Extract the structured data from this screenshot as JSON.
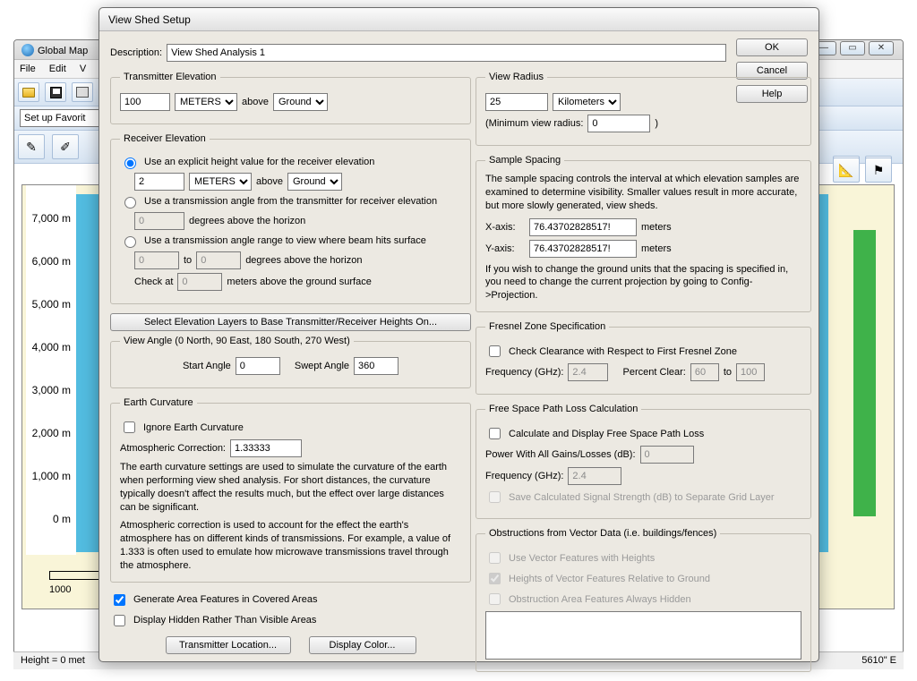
{
  "bgwin": {
    "title": "Global Map",
    "menus": [
      "File",
      "Edit",
      "V"
    ],
    "fav": "Set up Favorit"
  },
  "status": {
    "left": "Height = 0 met",
    "right": "5610\" E"
  },
  "yaxis": [
    "7,000 m",
    "6,000 m",
    "5,000 m",
    "4,000 m",
    "3,000 m",
    "2,000 m",
    "1,000 m",
    "0 m"
  ],
  "scale": "1000",
  "dialog": {
    "title": "View Shed Setup",
    "ok": "OK",
    "cancel": "Cancel",
    "help": "Help",
    "desc_label": "Description:",
    "desc": "View Shed Analysis 1",
    "tx": {
      "legend": "Transmitter Elevation",
      "val": "100",
      "unit": "METERS",
      "above": "above",
      "ref": "Ground"
    },
    "rx": {
      "legend": "Receiver Elevation",
      "opt1": "Use an explicit height value for the receiver elevation",
      "val": "2",
      "unit": "METERS",
      "above": "above",
      "ref": "Ground",
      "opt2": "Use a transmission angle from the transmitter for receiver elevation",
      "ang1": "0",
      "deg1": "degrees above the horizon",
      "opt3": "Use a transmission angle range to view where beam hits surface",
      "ang_from": "0",
      "to": "to",
      "ang_to": "0",
      "deg2": "degrees above the horizon",
      "checkat": "Check at",
      "checkval": "0",
      "checkunit": "meters above the ground surface"
    },
    "select_layers": "Select Elevation Layers to Base Transmitter/Receiver Heights On...",
    "viewangle": {
      "legend": "View Angle (0 North, 90 East, 180 South, 270 West)",
      "start_l": "Start Angle",
      "start": "0",
      "swept_l": "Swept Angle",
      "swept": "360"
    },
    "earth": {
      "legend": "Earth Curvature",
      "ignore": "Ignore Earth Curvature",
      "atm_l": "Atmospheric Correction:",
      "atm": "1.33333",
      "p1": "The earth curvature settings are used to simulate the curvature of the earth when performing view shed analysis. For short distances, the curvature typically doesn't affect the results much, but the effect over large distances can be significant.",
      "p2": "Atmospheric correction is used to account for the effect the earth's atmosphere has on different kinds of transmissions. For example, a value of 1.333 is often used to emulate how microwave transmissions travel through the atmosphere."
    },
    "gen": "Generate Area Features in Covered Areas",
    "disp": "Display Hidden Rather Than Visible Areas",
    "txloc": "Transmitter Location...",
    "dispcol": "Display Color...",
    "radius": {
      "legend": "View Radius",
      "val": "25",
      "unit": "Kilometers",
      "min_l": "(Minimum view radius:",
      "min": "0",
      "close": ")"
    },
    "spacing": {
      "legend": "Sample Spacing",
      "p": "The sample spacing controls the interval at which elevation samples are examined to determine visibility. Smaller values result in more accurate, but more slowly generated, view sheds.",
      "x_l": "X-axis:",
      "x": "76.43702828517!",
      "xu": "meters",
      "y_l": "Y-axis:",
      "y": "76.43702828517!",
      "yu": "meters",
      "p2": "If you wish to change the ground units that the spacing is specified in, you need to change the current projection by going to Config->Projection."
    },
    "fresnel": {
      "legend": "Fresnel Zone Specification",
      "check": "Check Clearance with Respect to First Fresnel Zone",
      "freq_l": "Frequency (GHz):",
      "freq": "2.4",
      "pc_l": "Percent Clear:",
      "pc_from": "60",
      "to": "to",
      "pc_to": "100"
    },
    "loss": {
      "legend": "Free Space Path Loss Calculation",
      "calc": "Calculate and Display Free Space Path Loss",
      "pw_l": "Power With All Gains/Losses (dB):",
      "pw": "0",
      "freq_l": "Frequency (GHz):",
      "freq": "2.4",
      "save": "Save Calculated Signal Strength (dB) to Separate Grid Layer"
    },
    "obs": {
      "legend": "Obstructions from Vector Data (i.e. buildings/fences)",
      "v1": "Use Vector Features with Heights",
      "v2": "Heights of Vector Features Relative to Ground",
      "v3": "Obstruction Area Features Always Hidden"
    }
  }
}
